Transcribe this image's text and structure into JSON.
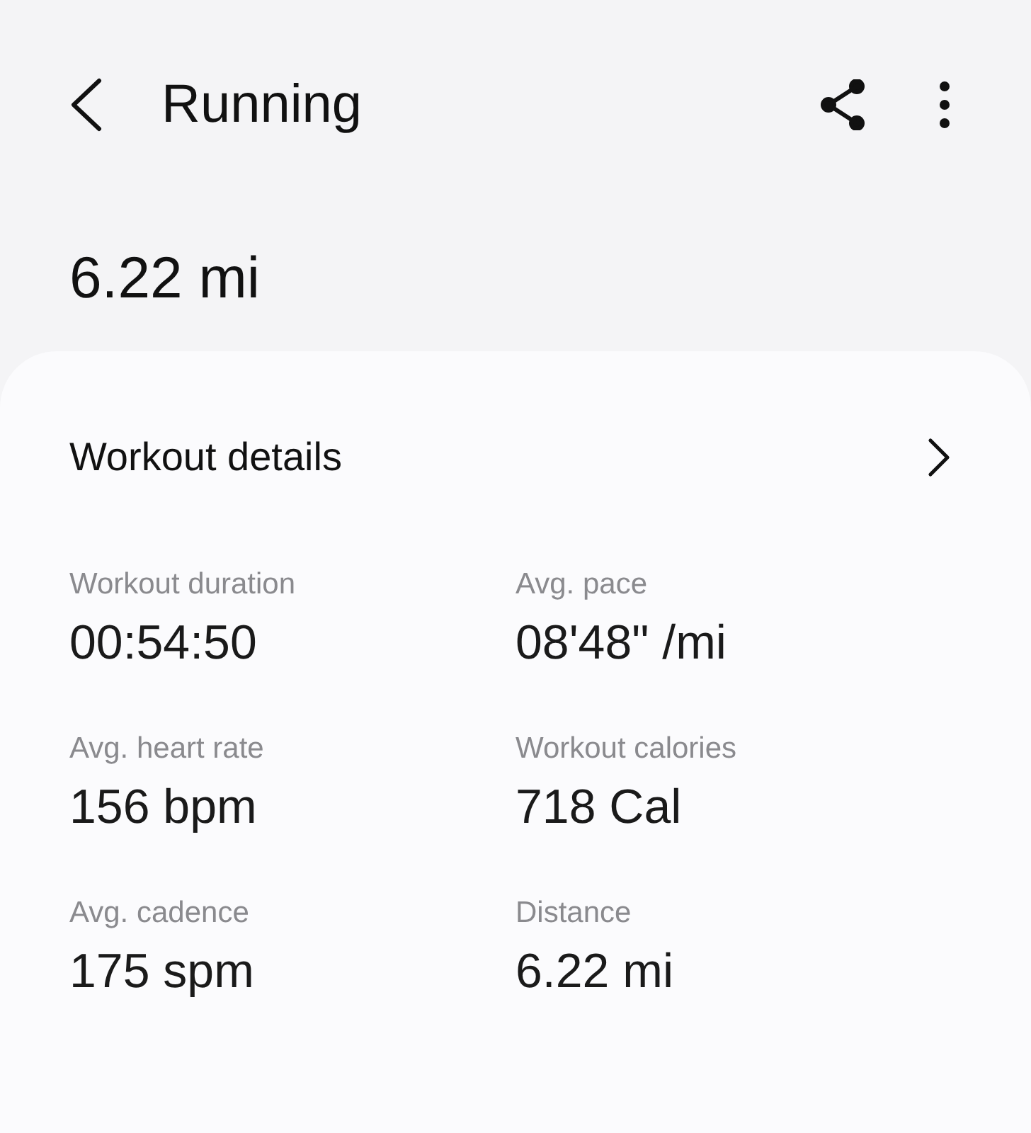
{
  "header": {
    "title": "Running"
  },
  "summary": {
    "distance": "6.22 mi"
  },
  "card": {
    "title": "Workout details",
    "stats": [
      {
        "label": "Workout duration",
        "value": "00:54:50"
      },
      {
        "label": "Avg. pace",
        "value": "08'48\" /mi"
      },
      {
        "label": "Avg. heart rate",
        "value": "156 bpm"
      },
      {
        "label": "Workout calories",
        "value": "718 Cal"
      },
      {
        "label": "Avg. cadence",
        "value": "175 spm"
      },
      {
        "label": "Distance",
        "value": "6.22 mi"
      }
    ]
  }
}
